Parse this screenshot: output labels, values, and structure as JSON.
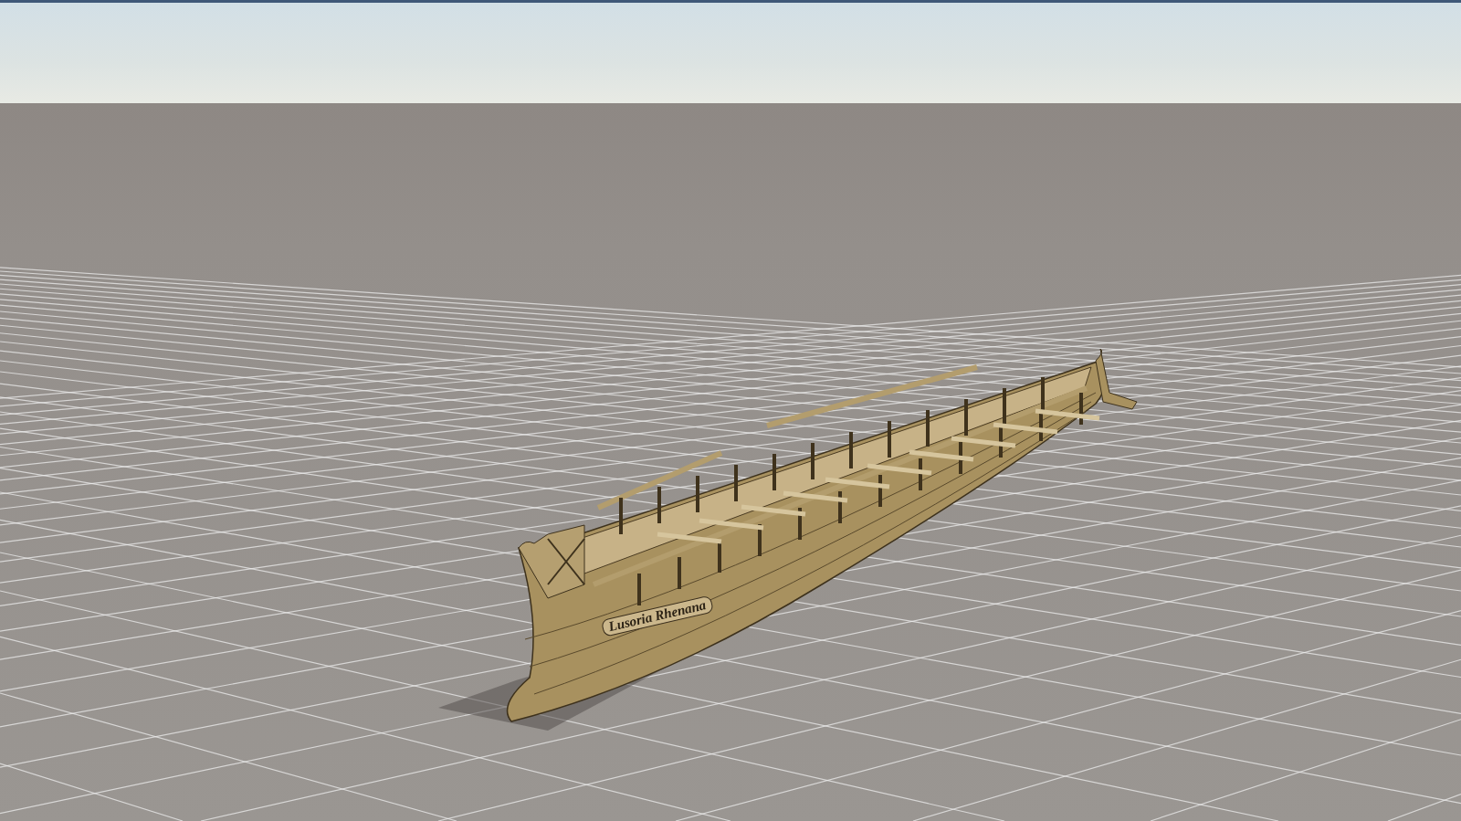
{
  "viewport": {
    "model": {
      "nameplate": "Lusoria Rhenana"
    }
  }
}
